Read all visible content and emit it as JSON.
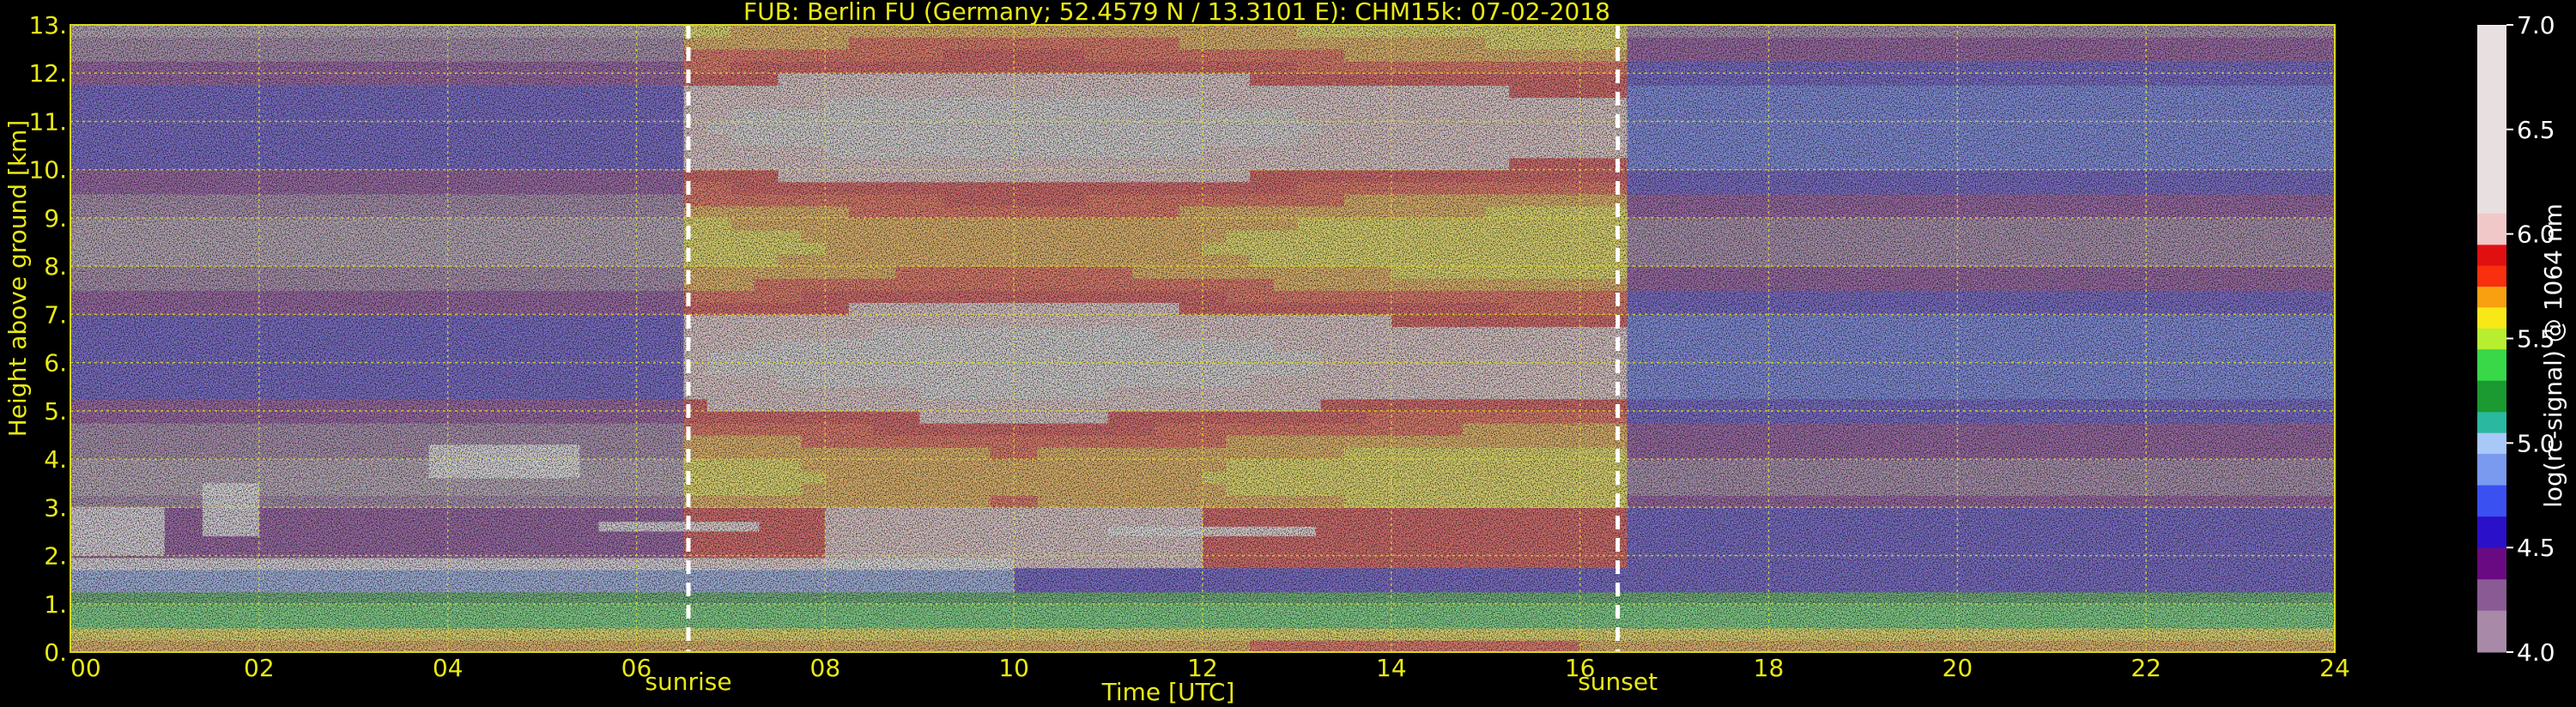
{
  "chart_data": {
    "type": "heatmap",
    "title": "FUB: Berlin FU (Germany; 52.4579 N / 13.3101 E):    CHM15k: 07-02-2018",
    "xlabel": "Time [UTC]",
    "ylabel": "Height above ground [km]",
    "colorbar_label": "log(rc-signal) @ 1064 nm",
    "xlim": [
      0,
      24
    ],
    "ylim": [
      0,
      13
    ],
    "clim": [
      4.0,
      7.0
    ],
    "x_ticks": [
      {
        "value": 0,
        "label": "00"
      },
      {
        "value": 2,
        "label": "02"
      },
      {
        "value": 4,
        "label": "04"
      },
      {
        "value": 6,
        "label": "06"
      },
      {
        "value": 8,
        "label": "08"
      },
      {
        "value": 10,
        "label": "10"
      },
      {
        "value": 12,
        "label": "12"
      },
      {
        "value": 14,
        "label": "14"
      },
      {
        "value": 16,
        "label": "16"
      },
      {
        "value": 18,
        "label": "18"
      },
      {
        "value": 20,
        "label": "20"
      },
      {
        "value": 22,
        "label": "22"
      },
      {
        "value": 24,
        "label": "24"
      }
    ],
    "y_ticks": [
      {
        "value": 0,
        "label": "0."
      },
      {
        "value": 1,
        "label": "1."
      },
      {
        "value": 2,
        "label": "2."
      },
      {
        "value": 3,
        "label": "3."
      },
      {
        "value": 4,
        "label": "4."
      },
      {
        "value": 5,
        "label": "5."
      },
      {
        "value": 6,
        "label": "6."
      },
      {
        "value": 7,
        "label": "7."
      },
      {
        "value": 8,
        "label": "8."
      },
      {
        "value": 9,
        "label": "9."
      },
      {
        "value": 10,
        "label": "10."
      },
      {
        "value": 11,
        "label": "11."
      },
      {
        "value": 12,
        "label": "12."
      },
      {
        "value": 13,
        "label": "13."
      }
    ],
    "colorbar_ticks": [
      {
        "value": 4.0,
        "label": "4.0"
      },
      {
        "value": 4.5,
        "label": "4.5"
      },
      {
        "value": 5.0,
        "label": "5.0"
      },
      {
        "value": 5.5,
        "label": "5.5"
      },
      {
        "value": 6.0,
        "label": "6.0"
      },
      {
        "value": 6.5,
        "label": "6.5"
      },
      {
        "value": 7.0,
        "label": "7.0"
      }
    ],
    "annotations": [
      {
        "x": 6.55,
        "label": "sunrise"
      },
      {
        "x": 16.4,
        "label": "sunset"
      }
    ],
    "grid": true,
    "colormap_stops": [
      {
        "value": 4.0,
        "color": "#a88aa8"
      },
      {
        "value": 4.2,
        "color": "#8a5a95"
      },
      {
        "value": 4.35,
        "color": "#6a0a82"
      },
      {
        "value": 4.5,
        "color": "#2a10c8"
      },
      {
        "value": 4.65,
        "color": "#3a50f0"
      },
      {
        "value": 4.8,
        "color": "#7a9af0"
      },
      {
        "value": 4.95,
        "color": "#a8c8f8"
      },
      {
        "value": 5.05,
        "color": "#2ab8a0"
      },
      {
        "value": 5.15,
        "color": "#1a9a30"
      },
      {
        "value": 5.3,
        "color": "#38d848"
      },
      {
        "value": 5.45,
        "color": "#b8ee30"
      },
      {
        "value": 5.55,
        "color": "#f8e818"
      },
      {
        "value": 5.65,
        "color": "#f8a010"
      },
      {
        "value": 5.75,
        "color": "#f83010"
      },
      {
        "value": 5.85,
        "color": "#e01010"
      },
      {
        "value": 5.95,
        "color": "#f0c8c8"
      },
      {
        "value": 6.1,
        "color": "#e8e0e0"
      },
      {
        "value": 7.0,
        "color": "#ffffff"
      }
    ],
    "colors": {
      "text": "#e8e817",
      "grid": "#d8d820",
      "marker": "#ffffff",
      "background": "#000000"
    }
  }
}
